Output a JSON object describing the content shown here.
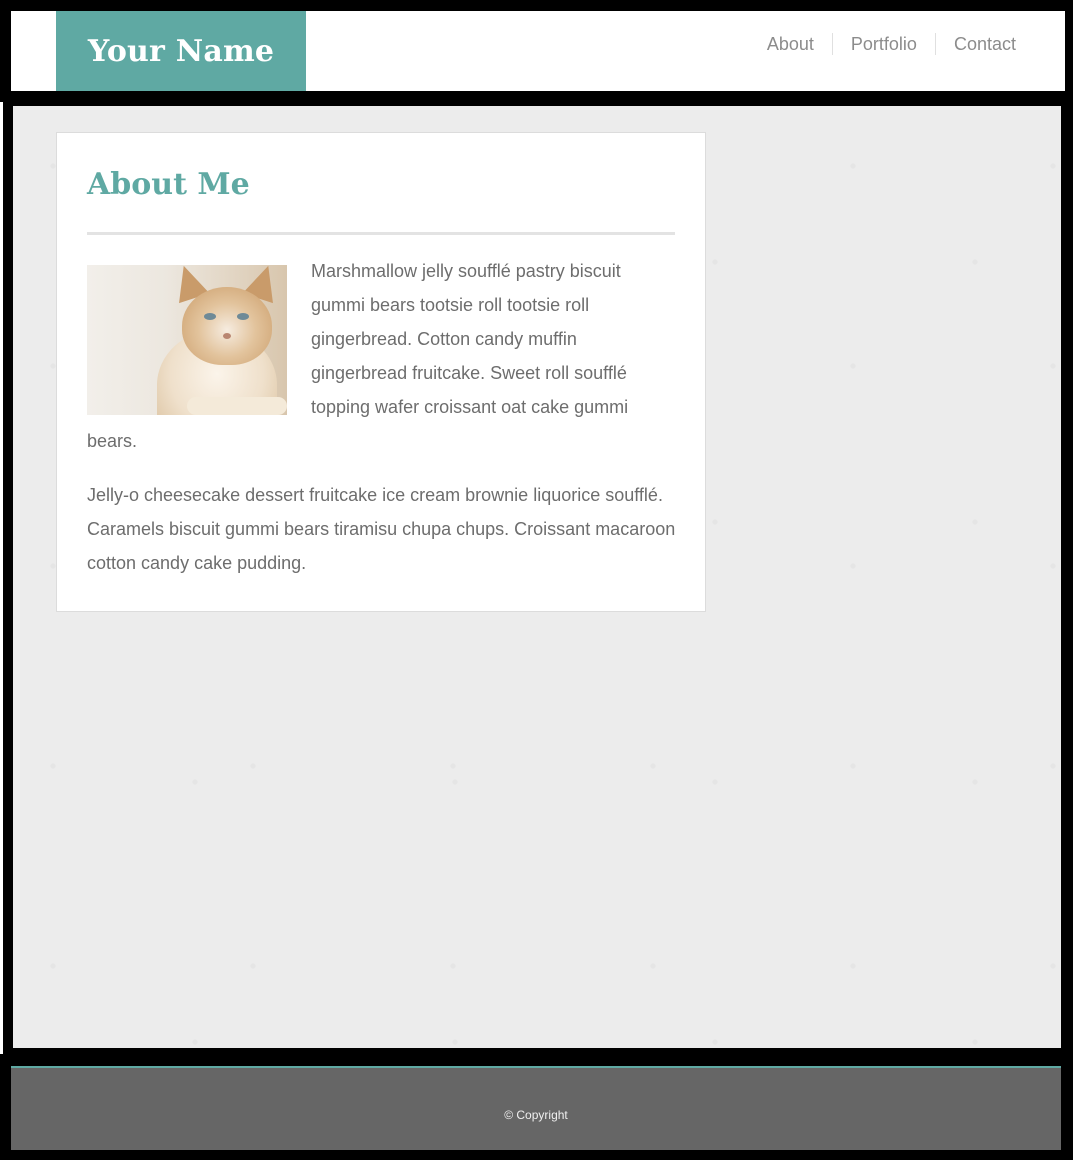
{
  "header": {
    "logo_text": "Your Name",
    "nav": [
      "About",
      "Portfolio",
      "Contact"
    ]
  },
  "card": {
    "title": "About Me",
    "paragraph_1": "Marshmallow jelly soufflé pastry biscuit gummi bears tootsie roll tootsie roll gingerbread. Cotton candy muffin gingerbread fruitcake. Sweet roll soufflé topping wafer croissant oat cake gummi bears.",
    "paragraph_2": "Jelly-o cheesecake dessert fruitcake ice cream brownie liquorice soufflé. Caramels biscuit gummi bears tiramisu chupa chups. Croissant macaroon cotton candy cake pudding."
  },
  "footer": {
    "copyright": "© Copyright"
  },
  "colors": {
    "accent": "#5fa9a3",
    "footer_bg": "#666666",
    "text": "#6d6d6d"
  }
}
